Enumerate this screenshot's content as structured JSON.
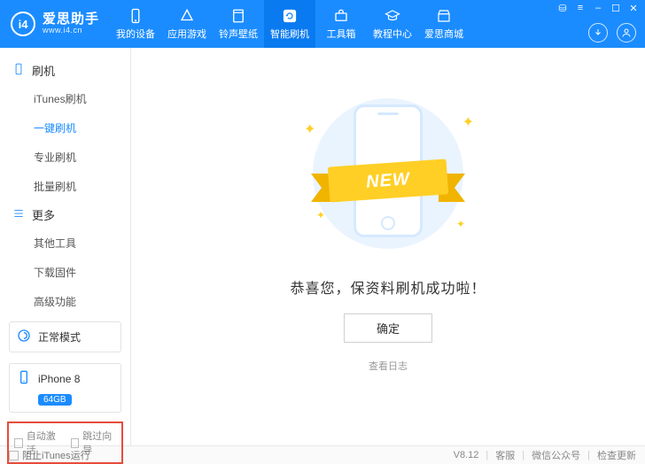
{
  "brand": {
    "badge": "i4",
    "title": "爱思助手",
    "url": "www.i4.cn"
  },
  "nav": [
    {
      "key": "device",
      "label": "我的设备"
    },
    {
      "key": "apps",
      "label": "应用游戏"
    },
    {
      "key": "ringwp",
      "label": "铃声壁纸"
    },
    {
      "key": "flash",
      "label": "智能刷机"
    },
    {
      "key": "toolbox",
      "label": "工具箱"
    },
    {
      "key": "tutorial",
      "label": "教程中心"
    },
    {
      "key": "mall",
      "label": "爱思商城"
    }
  ],
  "activeNavIndex": 3,
  "sidebar": {
    "sections": [
      {
        "key": "flash",
        "title": "刷机",
        "items": [
          {
            "key": "itunes",
            "label": "iTunes刷机"
          },
          {
            "key": "onekey",
            "label": "一键刷机"
          },
          {
            "key": "pro",
            "label": "专业刷机"
          },
          {
            "key": "batch",
            "label": "批量刷机"
          }
        ]
      },
      {
        "key": "more",
        "title": "更多",
        "items": [
          {
            "key": "other",
            "label": "其他工具"
          },
          {
            "key": "firmware",
            "label": "下载固件"
          },
          {
            "key": "advanced",
            "label": "高级功能"
          }
        ]
      }
    ],
    "activeSection": 0,
    "activeItem": 1,
    "mode": "正常模式",
    "device": {
      "name": "iPhone 8",
      "storage": "64GB"
    },
    "options": {
      "autoActivate": "自动激活",
      "skipGuide": "跳过向导"
    }
  },
  "main": {
    "ribbon": "NEW",
    "message": "恭喜您，保资料刷机成功啦！",
    "okButton": "确定",
    "logLink": "查看日志"
  },
  "footer": {
    "blockItunes": "阻止iTunes运行",
    "version": "V8.12",
    "support": "客服",
    "wechat": "微信公众号",
    "update": "检查更新"
  }
}
